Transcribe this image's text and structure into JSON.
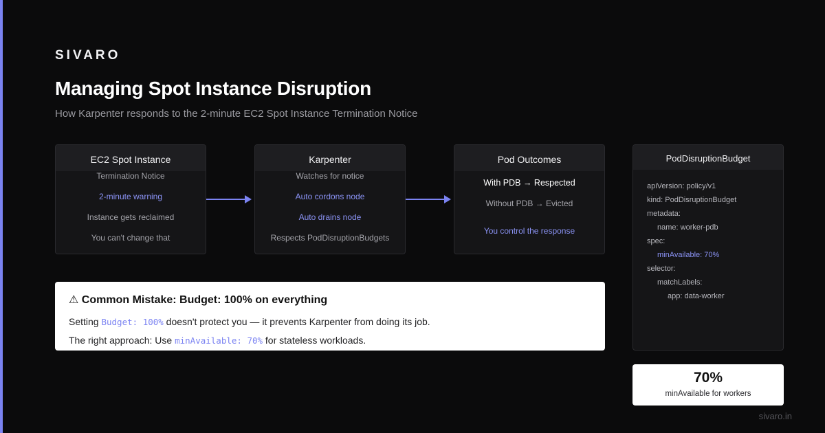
{
  "brand": "SIVARO",
  "title": "Managing Spot Instance Disruption",
  "subtitle": "How Karpenter responds to the 2-minute EC2 Spot Instance Termination Notice",
  "colors": {
    "accent": "#7b83f2",
    "background": "#0b0b0c",
    "card": "#151517"
  },
  "cards": [
    {
      "title": "EC2 Spot Instance",
      "rows": [
        "Termination Notice",
        "2-minute warning",
        "Instance gets reclaimed",
        "You can't change that"
      ]
    },
    {
      "title": "Karpenter",
      "rows": [
        "Watches for notice",
        "Auto cordons node",
        "Auto drains node",
        "Respects PodDisruptionBudgets"
      ]
    },
    {
      "title": "Pod Outcomes",
      "rows": [
        "With PDB → Respected",
        "Without PDB → Evicted",
        "You control the response"
      ]
    }
  ],
  "yaml_card": {
    "title": "PodDisruptionBudget",
    "lines": [
      "apiVersion: policy/v1",
      "kind: PodDisruptionBudget",
      "metadata:",
      "name: worker-pdb",
      "spec:",
      "minAvailable: 70%",
      "selector:",
      "matchLabels:",
      "app: data-worker"
    ]
  },
  "mistake": {
    "title": "⚠ Common Mistake: Budget: 100% on everything",
    "line1_prefix": "Setting ",
    "line1_code": "Budget: 100%",
    "line1_suffix": " doesn't protect you — it prevents Karpenter from doing its job.",
    "line2_prefix": "The right approach: Use ",
    "line2_code": "minAvailable: 70%",
    "line2_suffix": " for stateless workloads."
  },
  "stat": {
    "value": "70%",
    "label": "minAvailable for workers"
  },
  "footer": "sivaro.in"
}
